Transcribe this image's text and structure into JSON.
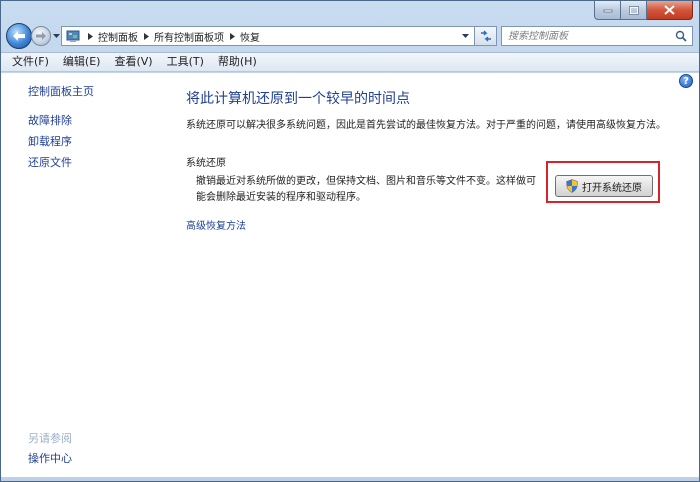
{
  "address": {
    "crumbs": [
      "控制面板",
      "所有控制面板项",
      "恢复"
    ]
  },
  "search": {
    "placeholder": "搜索控制面板"
  },
  "menu": {
    "items": [
      "文件(F)",
      "编辑(E)",
      "查看(V)",
      "工具(T)",
      "帮助(H)"
    ]
  },
  "sidebar": {
    "home_link": "控制面板主页",
    "links": [
      "故障排除",
      "卸载程序",
      "还原文件"
    ],
    "see_also_title": "另请参阅",
    "see_also_links": [
      "操作中心"
    ]
  },
  "main": {
    "heading": "将此计算机还原到一个较早的时间点",
    "intro": "系统还原可以解决很多系统问题，因此是首先尝试的最佳恢复方法。对于严重的问题，请使用高级恢复方法。",
    "section_title": "系统还原",
    "section_desc": "撤销最近对系统所做的更改，但保持文档、图片和音乐等文件不变。这样做可能会删除最近安装的程序和驱动程序。",
    "open_button": "打开系统还原",
    "advanced_link": "高级恢复方法"
  },
  "help_label": "?",
  "colors": {
    "link": "#1f3f94",
    "highlight": "#d9222a"
  },
  "icons": {
    "back": "back-arrow-icon",
    "forward": "forward-arrow-icon",
    "control_panel": "control-panel-icon",
    "search": "search-icon",
    "refresh": "refresh-icon",
    "shield": "uac-shield-icon",
    "help": "help-icon"
  }
}
